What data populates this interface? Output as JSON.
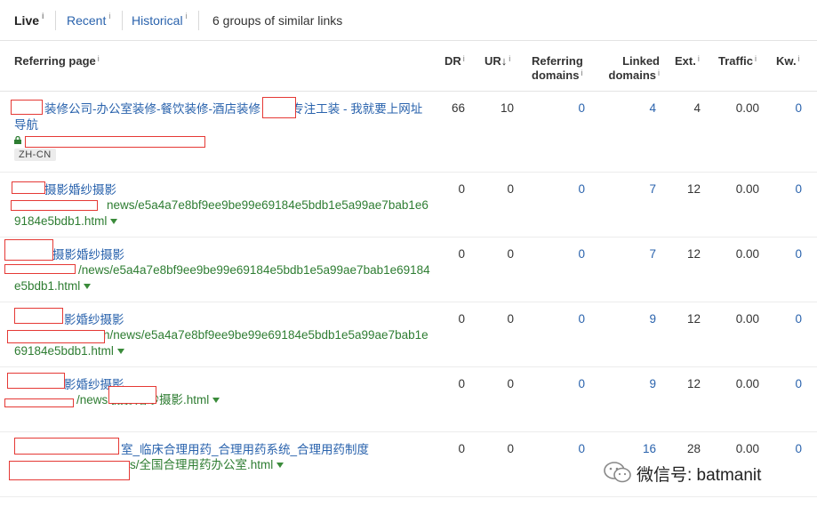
{
  "tabs": {
    "live": "Live",
    "recent": "Recent",
    "historical": "Historical",
    "info": "i",
    "groups_text": "6 groups of similar links"
  },
  "columns": {
    "referring_page": "Referring page",
    "dr": "DR",
    "ur": "UR",
    "ur_sort_glyph": "↓",
    "referring_domains_1": "Referring",
    "referring_domains_2": "domains",
    "linked_domains_1": "Linked",
    "linked_domains_2": "domains",
    "ext": "Ext.",
    "traffic": "Traffic",
    "kw": "Kw.",
    "info": "i"
  },
  "rows": [
    {
      "title": "装修公司-办公室装修-餐饮装修-酒店装修 装饰-专注工装 - 我就要上网址导航",
      "url": "",
      "lang": "ZH-CN",
      "dr": "66",
      "ur": "10",
      "ref_domains": "0",
      "linked_domains": "4",
      "ext": "4",
      "traffic": "0.00",
      "kw": "0"
    },
    {
      "title": "摄影婚纱摄影",
      "url": "news/e5a4a7e8bf9ee9be99e69184e5bdb1e5a99ae7bab1e69184e5bdb1.html",
      "dr": "0",
      "ur": "0",
      "ref_domains": "0",
      "linked_domains": "7",
      "ext": "12",
      "traffic": "0.00",
      "kw": "0"
    },
    {
      "title": "摄影婚纱摄影",
      "url": "/news/e5a4a7e8bf9ee9be99e69184e5bdb1e5a99ae7bab1e69184e5bdb1.html",
      "dr": "0",
      "ur": "0",
      "ref_domains": "0",
      "linked_domains": "7",
      "ext": "12",
      "traffic": "0.00",
      "kw": "0"
    },
    {
      "title": "影婚纱摄影",
      "url": "n/news/e5a4a7e8bf9ee9be99e69184e5bdb1e5a99ae7bab1e69184e5bdb1.html",
      "dr": "0",
      "ur": "0",
      "ref_domains": "0",
      "linked_domains": "9",
      "ext": "12",
      "traffic": "0.00",
      "kw": "0"
    },
    {
      "title": "影婚纱摄影",
      "url": "/news 摄影婚纱摄影.html",
      "dr": "0",
      "ur": "0",
      "ref_domains": "0",
      "linked_domains": "9",
      "ext": "12",
      "traffic": "0.00",
      "kw": "0"
    },
    {
      "title": "室_临床合理用药_合理用药系统_合理用药制度",
      "url": "s/全国合理用药办公室.html",
      "dr": "0",
      "ur": "0",
      "ref_domains": "0",
      "linked_domains": "16",
      "ext": "28",
      "traffic": "0.00",
      "kw": "0"
    }
  ],
  "watermark": "微信号: batmanit",
  "colors": {
    "link": "#2a63ad",
    "url": "#2e7d32",
    "redaction": "#e53935"
  }
}
